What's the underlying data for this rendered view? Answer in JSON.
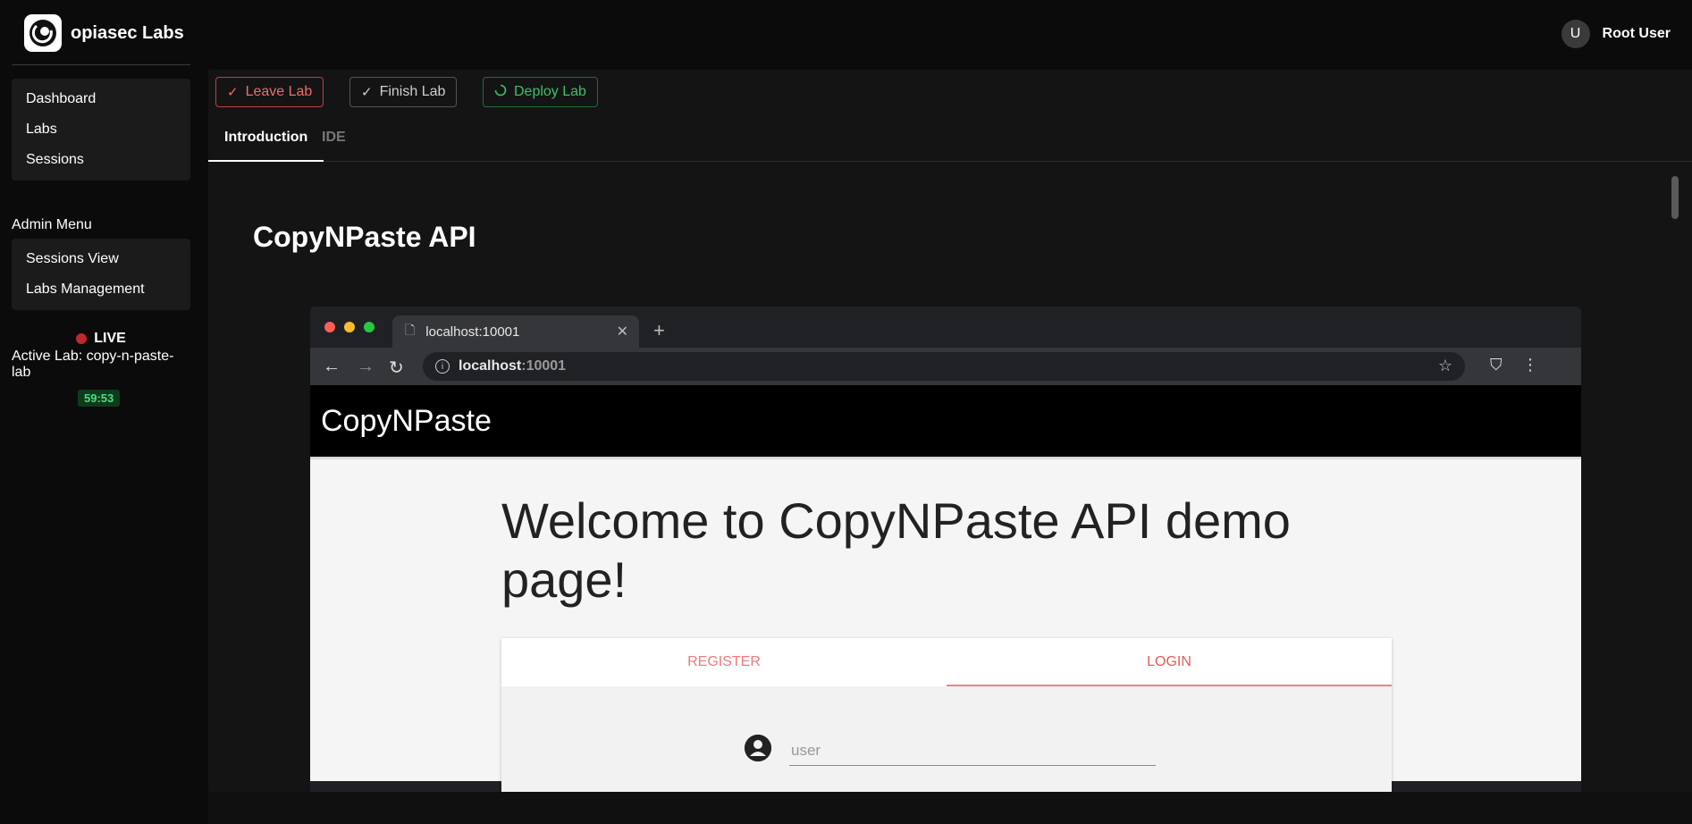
{
  "brand": {
    "name": "opiasec Labs",
    "icon": "opiasec-logo-icon"
  },
  "nav": {
    "items": [
      {
        "label": "Dashboard"
      },
      {
        "label": "Labs"
      },
      {
        "label": "Sessions"
      }
    ]
  },
  "admin": {
    "title": "Admin Menu",
    "items": [
      {
        "label": "Sessions View"
      },
      {
        "label": "Labs Management"
      }
    ]
  },
  "live": {
    "status": "LIVE",
    "active_lab": "Active Lab: copy-n-paste-lab",
    "timer": "59:53",
    "status_color": "#c0292b"
  },
  "user": {
    "initial": "U",
    "name": "Root User"
  },
  "actions": {
    "leave": "Leave Lab",
    "finish": "Finish Lab",
    "deploy": "Deploy Lab"
  },
  "tabs": [
    {
      "label": "Introduction",
      "active": true
    },
    {
      "label": "IDE",
      "active": false
    }
  ],
  "page": {
    "title": "CopyNPaste API"
  },
  "screenshot": {
    "tab_title": "localhost:10001",
    "url_host": "localhost",
    "url_port": ":10001",
    "site_name": "CopyNPaste",
    "welcome": "Welcome to CopyNPaste API demo page!",
    "card_tabs": [
      {
        "label": "REGISTER",
        "active": false
      },
      {
        "label": "LOGIN",
        "active": true
      }
    ],
    "username_placeholder": "user"
  },
  "colors": {
    "leave": "#f16c6c",
    "deploy": "#3fbf6a",
    "timer_text": "#4ade80",
    "accent_login": "#e55c5c"
  }
}
